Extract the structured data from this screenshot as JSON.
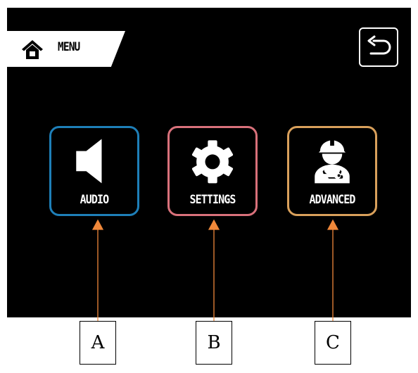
{
  "header": {
    "menu_label": "MENU",
    "home_icon": "home-icon",
    "back_icon": "back-arrow-icon"
  },
  "tiles": [
    {
      "label": "AUDIO",
      "icon": "speaker-icon",
      "border_color": "#1e7fb8"
    },
    {
      "label": "SETTINGS",
      "icon": "gear-icon",
      "border_color": "#d9717b"
    },
    {
      "label": "ADVANCED",
      "icon": "engineer-wrench-icon",
      "border_color": "#d9a05b"
    }
  ],
  "callouts": [
    "A",
    "B",
    "C"
  ],
  "colors": {
    "screen_bg": "#000000",
    "arrow": "#f0883a",
    "text": "#ffffff"
  }
}
